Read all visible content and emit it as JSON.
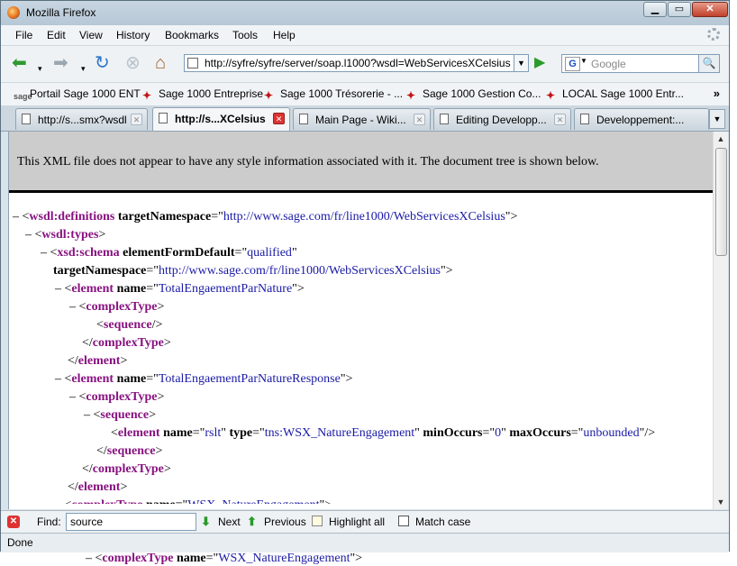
{
  "window": {
    "title": "Mozilla Firefox"
  },
  "menu": [
    "File",
    "Edit",
    "View",
    "History",
    "Bookmarks",
    "Tools",
    "Help"
  ],
  "nav": {
    "url": "http://syfre/syfre/server/soap.l1000?wsdl=WebServicesXCelsius",
    "search_placeholder": "Google"
  },
  "bookmarks": [
    "Portail Sage 1000 ENT",
    "Sage 1000 Entreprise",
    "Sage 1000 Trésorerie - ...",
    "Sage 1000 Gestion Co...",
    "LOCAL Sage 1000 Entr..."
  ],
  "bookmarks_more": "»",
  "tabs": [
    "http://s...smx?wsdl",
    "http://s...XCelsius",
    "Main Page - Wiki...",
    "Editing Developp...",
    "Developpement:..."
  ],
  "content": {
    "info": "This XML file does not appear to have any style information associated with it. The document tree is shown below.",
    "ns": "http://www.sage.com/fr/line1000/WebServicesXCelsius",
    "elem1": "TotalEngaementParNature",
    "elem2": "TotalEngaementParNatureResponse",
    "rslt_name": "rslt",
    "rslt_type": "tns:WSX_NatureEngagement",
    "min": "0",
    "max": "unbounded",
    "form_default": "qualified",
    "partial_name": "WSX_NatureEngagement"
  },
  "find": {
    "label": "Find:",
    "value": "source",
    "next": "Next",
    "previous": "Previous",
    "highlight": "Highlight all",
    "match_case": "Match case"
  },
  "status": "Done"
}
